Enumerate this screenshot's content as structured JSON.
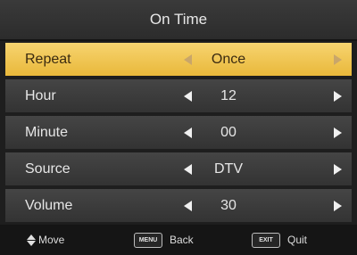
{
  "header": {
    "title": "On Time"
  },
  "menu": {
    "rows": [
      {
        "label": "Repeat",
        "value": "Once",
        "selected": true
      },
      {
        "label": "Hour",
        "value": "12",
        "selected": false
      },
      {
        "label": "Minute",
        "value": "00",
        "selected": false
      },
      {
        "label": "Source",
        "value": "DTV",
        "selected": false
      },
      {
        "label": "Volume",
        "value": "30",
        "selected": false
      }
    ]
  },
  "footer": {
    "move_label": "Move",
    "menu_key": "MENU",
    "back_label": "Back",
    "exit_key": "EXIT",
    "quit_label": "Quit"
  },
  "colors": {
    "selected_row": "#f0c44f",
    "row": "#3c3c3c",
    "background": "#1e1e1e"
  }
}
